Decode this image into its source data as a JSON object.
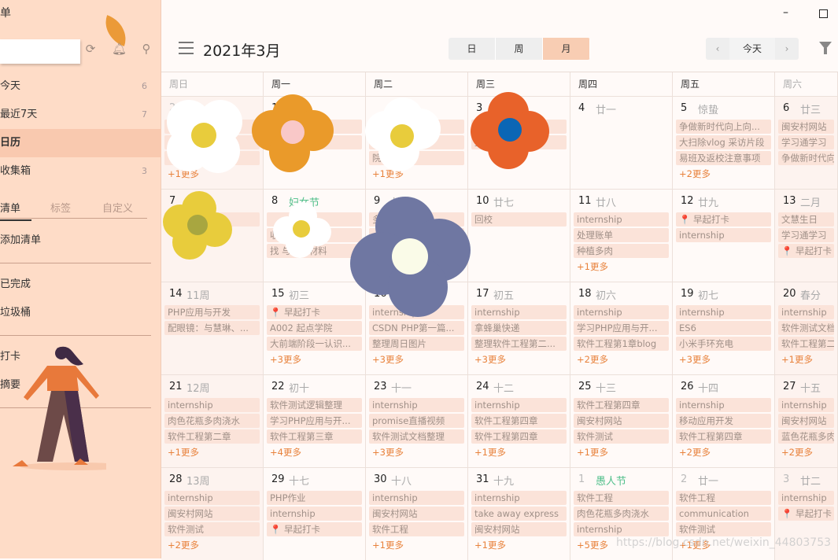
{
  "sidebar": {
    "title": "单",
    "nav": [
      {
        "label": "今天",
        "count": "6"
      },
      {
        "label": "最近7天",
        "count": "7"
      },
      {
        "label": "日历",
        "count": ""
      },
      {
        "label": "收集箱",
        "count": "3"
      }
    ],
    "tabs": [
      "清单",
      "标签",
      "自定义"
    ],
    "add_list": "添加清单",
    "completed": "已完成",
    "trash": "垃圾桶",
    "checkin": "打卡",
    "summary": "摘要"
  },
  "header": {
    "title": "2021年3月",
    "views": [
      "日",
      "周",
      "月"
    ],
    "active_view": "月",
    "today": "今天"
  },
  "weekdays": [
    "周日",
    "周一",
    "周二",
    "周三",
    "周四",
    "周五",
    "周六"
  ],
  "colors": {
    "accent": "#e8823c",
    "event_bg": "#fbe3d9",
    "festival": "#4fbf8a",
    "sidebar": "#fedcc7"
  },
  "weeks": [
    [
      {
        "d": "2",
        "o": true,
        "l": "",
        "e": [
          "",
          "",
          ""
        ],
        "m": "+1更多"
      },
      {
        "d": "1",
        "l": "",
        "e": [
          "院",
          ""
        ],
        "m": ""
      },
      {
        "d": "",
        "l": "",
        "e": [
          "只...",
          "",
          "院"
        ],
        "m": "+1更多"
      },
      {
        "d": "3",
        "l": "",
        "e": [
          "",
          "王"
        ],
        "m": ""
      },
      {
        "d": "4",
        "l": "廿一",
        "e": [],
        "m": ""
      },
      {
        "d": "5",
        "l": "惊蛰",
        "e": [
          "争做新时代向上向...",
          "大扫除vlog 采访片段",
          "易班及返校注意事项"
        ],
        "m": "+2更多"
      },
      {
        "d": "6",
        "l": "廿三",
        "e": [
          "闽安村网站",
          "学习通学习",
          "争做新时代向上向..."
        ],
        "m": ""
      }
    ],
    [
      {
        "d": "7",
        "l": "",
        "e": [
          ""
        ],
        "m": ""
      },
      {
        "d": "8",
        "l": "妇女节",
        "f": true,
        "e": [
          "",
          "收",
          "找    与返校材料"
        ],
        "m": ""
      },
      {
        "d": "9",
        "l": "廿六",
        "e": [
          "         多肉",
          ""
        ],
        "m": ""
      },
      {
        "d": "10",
        "l": "廿七",
        "e": [
          "回校"
        ],
        "m": ""
      },
      {
        "d": "11",
        "l": "廿八",
        "e": [
          "internship",
          "处理账单",
          "种植多肉"
        ],
        "m": "+1更多"
      },
      {
        "d": "12",
        "l": "廿九",
        "e": [
          "📍 早起打卡",
          "internship"
        ],
        "m": ""
      },
      {
        "d": "13",
        "l": "二月",
        "e": [
          "文慧生日",
          "学习通学习",
          "📍 早起打卡"
        ],
        "m": ""
      }
    ],
    [
      {
        "d": "14",
        "l": "11周",
        "e": [
          "PHP应用与开发",
          "配眼镜：与慧琳、..."
        ],
        "m": ""
      },
      {
        "d": "15",
        "l": "初三",
        "e": [
          "📍 早起打卡",
          "A002 起点学院",
          "大前端阶段一认识..."
        ],
        "m": "+3更多"
      },
      {
        "d": "16",
        "l": "",
        "e": [
          "internship",
          "CSDN PHP第一篇...",
          "整理周日图片"
        ],
        "m": "+3更多"
      },
      {
        "d": "17",
        "l": "初五",
        "e": [
          "internship",
          "拿蜂巢快递",
          "整理软件工程第二..."
        ],
        "m": "+3更多"
      },
      {
        "d": "18",
        "l": "初六",
        "e": [
          "internship",
          "学习PHP应用与开...",
          "软件工程第1章blog"
        ],
        "m": "+2更多"
      },
      {
        "d": "19",
        "l": "初七",
        "e": [
          "internship",
          "ES6",
          "小米手环充电"
        ],
        "m": "+3更多"
      },
      {
        "d": "20",
        "l": "春分",
        "e": [
          "internship",
          "软件测试文档整理",
          "软件工程第二章"
        ],
        "m": "+1更多"
      }
    ],
    [
      {
        "d": "21",
        "l": "12周",
        "e": [
          "internship",
          "肉色花瓶多肉浇水",
          "软件工程第二章"
        ],
        "m": "+1更多"
      },
      {
        "d": "22",
        "l": "初十",
        "e": [
          "软件测试逻辑整理",
          "学习PHP应用与开...",
          "软件工程第三章"
        ],
        "m": "+4更多"
      },
      {
        "d": "23",
        "l": "十一",
        "e": [
          "internship",
          "promise直播视频",
          "软件测试文档整理"
        ],
        "m": "+3更多"
      },
      {
        "d": "24",
        "l": "十二",
        "e": [
          "internship",
          "软件工程第四章",
          "软件工程第四章"
        ],
        "m": "+1更多"
      },
      {
        "d": "25",
        "l": "十三",
        "e": [
          "软件工程第四章",
          "闽安村网站",
          "软件测试"
        ],
        "m": "+1更多"
      },
      {
        "d": "26",
        "l": "十四",
        "e": [
          "internship",
          "移动应用开发",
          "软件工程第四章"
        ],
        "m": "+2更多"
      },
      {
        "d": "27",
        "l": "十五",
        "e": [
          "internship",
          "闽安村网站",
          "蓝色花瓶多肉浇水"
        ],
        "m": "+2更多"
      }
    ],
    [
      {
        "d": "28",
        "l": "13周",
        "e": [
          "internship",
          "闽安村网站",
          "软件测试"
        ],
        "m": "+2更多"
      },
      {
        "d": "29",
        "l": "十七",
        "e": [
          "PHP作业",
          "internship",
          "📍 早起打卡"
        ],
        "m": ""
      },
      {
        "d": "30",
        "l": "十八",
        "e": [
          "internship",
          "闽安村网站",
          "软件工程"
        ],
        "m": "+1更多"
      },
      {
        "d": "31",
        "l": "十九",
        "e": [
          "internship",
          "take away express",
          "闽安村网站"
        ],
        "m": "+1更多"
      },
      {
        "d": "1",
        "o": true,
        "l": "愚人节",
        "f": true,
        "e": [
          "软件工程",
          "肉色花瓶多肉浇水",
          "internship"
        ],
        "m": "+5更多"
      },
      {
        "d": "2",
        "o": true,
        "l": "廿一",
        "e": [
          "软件工程",
          "communication",
          "软件测试"
        ],
        "m": "+1更多"
      },
      {
        "d": "3",
        "o": true,
        "l": "廿二",
        "e": [
          "internship",
          "📍 早起打卡"
        ],
        "m": ""
      }
    ]
  ],
  "watermark": "https://blog.csdn.net/weixin_44803753"
}
